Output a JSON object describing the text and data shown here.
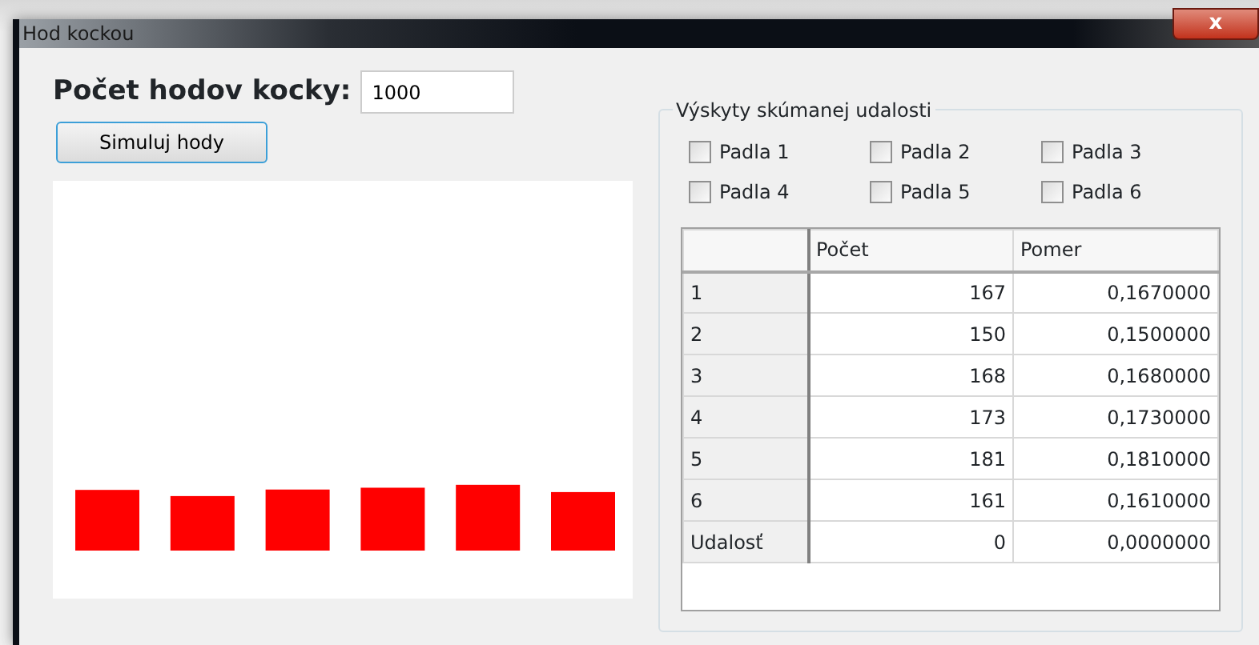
{
  "window": {
    "title": "Hod kockou",
    "close_label": "x"
  },
  "controls": {
    "count_label": "Počet hodov kocky:",
    "count_value": "1000",
    "simulate_button": "Simuluj hody"
  },
  "events": {
    "title": "Výskyty skúmanej udalosti",
    "checkboxes": [
      {
        "label": "Padla 1",
        "checked": false
      },
      {
        "label": "Padla 2",
        "checked": false
      },
      {
        "label": "Padla 3",
        "checked": false
      },
      {
        "label": "Padla 4",
        "checked": false
      },
      {
        "label": "Padla 5",
        "checked": false
      },
      {
        "label": "Padla 6",
        "checked": false
      }
    ]
  },
  "table": {
    "columns": [
      "Počet",
      "Pomer"
    ],
    "rows": [
      {
        "label": "1",
        "count": "167",
        "ratio": "0,1670000"
      },
      {
        "label": "2",
        "count": "150",
        "ratio": "0,1500000"
      },
      {
        "label": "3",
        "count": "168",
        "ratio": "0,1680000"
      },
      {
        "label": "4",
        "count": "173",
        "ratio": "0,1730000"
      },
      {
        "label": "5",
        "count": "181",
        "ratio": "0,1810000"
      },
      {
        "label": "6",
        "count": "161",
        "ratio": "0,1610000"
      },
      {
        "label": "Udalosť",
        "count": "0",
        "ratio": "0,0000000"
      }
    ]
  }
}
